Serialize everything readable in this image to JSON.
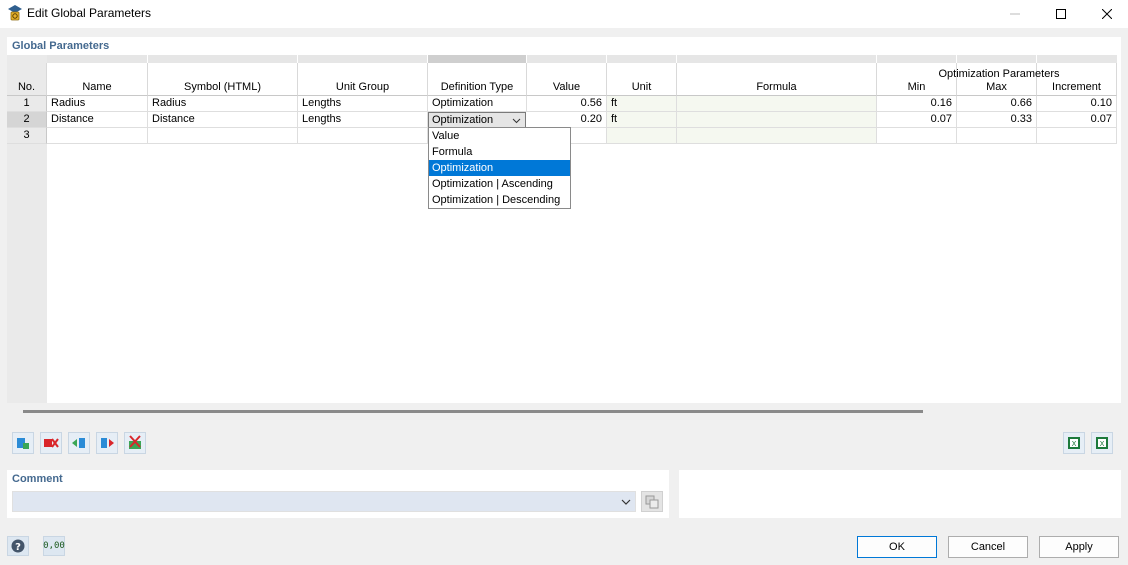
{
  "window": {
    "title": "Edit Global Parameters"
  },
  "panel": {
    "title": "Global Parameters"
  },
  "table": {
    "group_header": "Optimization Parameters",
    "headers": {
      "no": "No.",
      "name": "Name",
      "symbol": "Symbol (HTML)",
      "unit_group": "Unit Group",
      "definition_type": "Definition Type",
      "value": "Value",
      "unit": "Unit",
      "formula": "Formula",
      "min": "Min",
      "max": "Max",
      "increment": "Increment"
    },
    "rows": [
      {
        "no": "1",
        "name": "Radius",
        "symbol": "Radius",
        "unit_group": "Lengths",
        "definition_type": "Optimization",
        "value": "0.56",
        "unit": "ft",
        "formula": "",
        "min": "0.16",
        "max": "0.66",
        "increment": "0.10"
      },
      {
        "no": "2",
        "name": "Distance",
        "symbol": "Distance",
        "unit_group": "Lengths",
        "definition_type": "Optimization",
        "value": "0.20",
        "unit": "ft",
        "formula": "",
        "min": "0.07",
        "max": "0.33",
        "increment": "0.07"
      },
      {
        "no": "3",
        "name": "",
        "symbol": "",
        "unit_group": "",
        "definition_type": "",
        "value": "",
        "unit": "",
        "formula": "",
        "min": "",
        "max": "",
        "increment": ""
      }
    ]
  },
  "dropdown": {
    "selected": "Optimization",
    "options": [
      "Value",
      "Formula",
      "Optimization",
      "Optimization | Ascending",
      "Optimization | Descending"
    ]
  },
  "comment": {
    "title": "Comment",
    "value": ""
  },
  "buttons": {
    "ok": "OK",
    "cancel": "Cancel",
    "apply": "Apply"
  },
  "footer": {
    "units_icon_text": "0,00"
  },
  "icons": {
    "app": "global-parameters-icon",
    "minimize": "minimize-icon",
    "maximize": "maximize-icon",
    "close": "close-icon",
    "toolbar": [
      "insert-row-icon",
      "delete-row-icon",
      "import-icon",
      "export-icon",
      "delete-all-icon"
    ],
    "toolbar_right": [
      "excel-export-icon",
      "excel-import-icon"
    ],
    "help": "help-icon",
    "units": "units-decimal-icon"
  },
  "colors": {
    "accent": "#0078d7",
    "section_title": "#44698f",
    "delete_red": "#d9262b"
  }
}
